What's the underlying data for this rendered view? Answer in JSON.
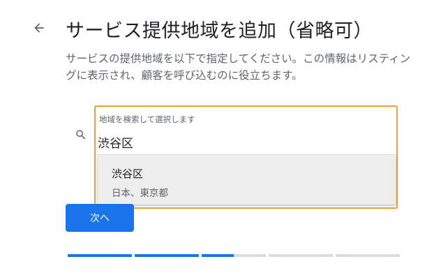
{
  "page": {
    "title": "サービス提供地域を追加（省略可）",
    "description": "サービスの提供地域を以下で指定してください。この情報はリスティングに表示され、顧客を呼び込むのに役立ちます。"
  },
  "nav": {
    "back_icon": "arrow-left-icon"
  },
  "search": {
    "icon": "search-icon",
    "label": "地域を検索して選択します",
    "value": "渋谷区",
    "accent_color": "#f09d3c"
  },
  "suggestions": [
    {
      "name": "渋谷区",
      "detail": "日本、東京都"
    }
  ],
  "actions": {
    "next_label": "次へ",
    "button_color": "#1a73e8"
  },
  "progress": {
    "active_color": "#1a73e8",
    "inactive_color": "#dadce0",
    "segments": [
      1,
      1,
      0.5,
      0,
      0
    ]
  }
}
